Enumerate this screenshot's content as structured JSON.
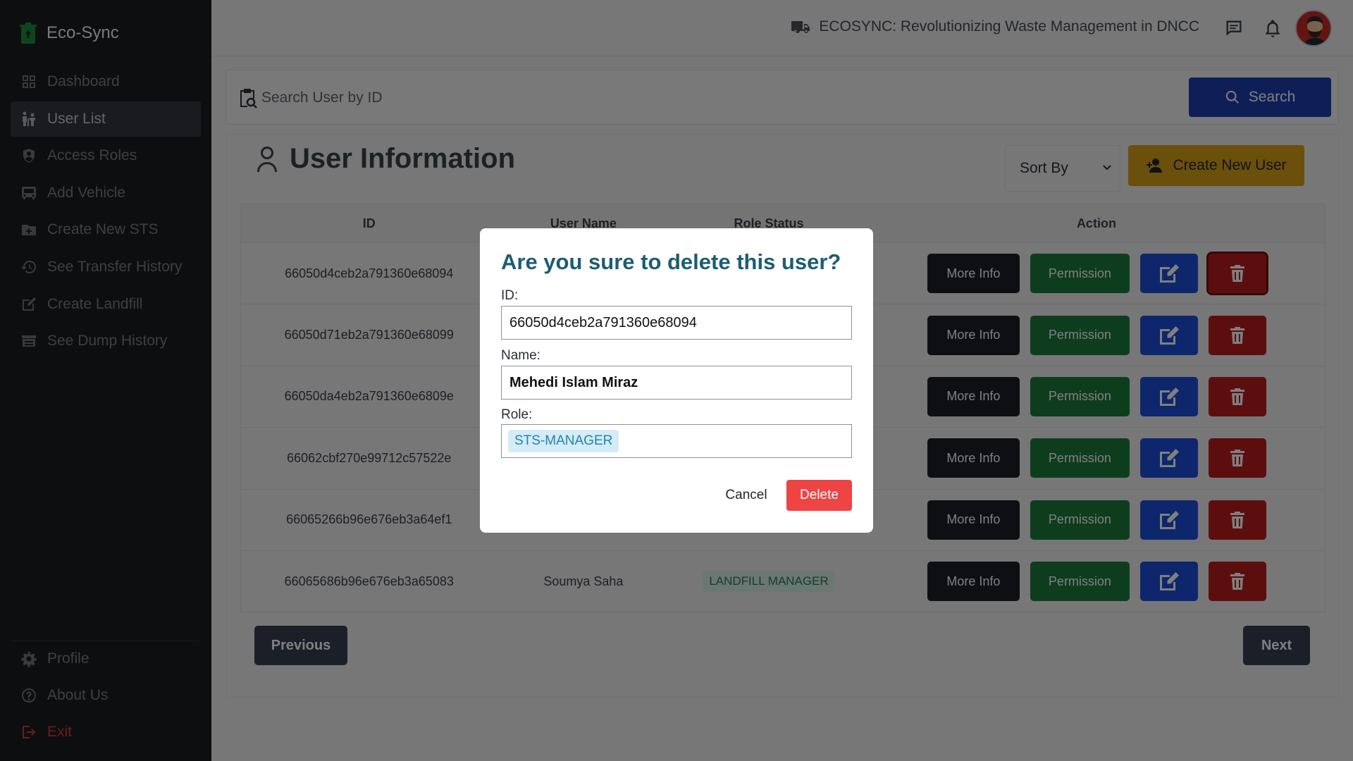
{
  "app": {
    "name": "Eco-Sync"
  },
  "sidebar": {
    "items": [
      {
        "label": "Dashboard",
        "icon": "dashboard-icon"
      },
      {
        "label": "User List",
        "icon": "users-icon",
        "active": true
      },
      {
        "label": "Access Roles",
        "icon": "shield-icon"
      },
      {
        "label": "Add Vehicle",
        "icon": "bus-icon"
      },
      {
        "label": "Create New STS",
        "icon": "folder-plus-icon"
      },
      {
        "label": "See Transfer History",
        "icon": "history-icon"
      },
      {
        "label": "Create Landfill",
        "icon": "edit-icon"
      },
      {
        "label": "See Dump History",
        "icon": "warehouse-icon"
      }
    ],
    "bottom_items": [
      {
        "label": "Profile",
        "icon": "gear-icon"
      },
      {
        "label": "About Us",
        "icon": "help-icon"
      },
      {
        "label": "Exit",
        "icon": "exit-icon"
      }
    ]
  },
  "topbar": {
    "title": "ECOSYNC: Revolutionizing Waste Management in DNCC"
  },
  "search": {
    "placeholder": "Search User by ID",
    "button_label": "Search"
  },
  "panel": {
    "title": "User Information",
    "sort_label": "Sort By",
    "create_label": "Create New User"
  },
  "table": {
    "headers": {
      "id": "ID",
      "name": "User Name",
      "role": "Role Status",
      "action": "Action"
    },
    "rows": [
      {
        "id": "66050d4ceb2a791360e68094",
        "name": "",
        "role": ""
      },
      {
        "id": "66050d71eb2a791360e68099",
        "name": "",
        "role": ""
      },
      {
        "id": "66050da4eb2a791360e6809e",
        "name": "",
        "role": ""
      },
      {
        "id": "66062cbf270e99712c57522e",
        "name": "",
        "role": ""
      },
      {
        "id": "66065266b96e676eb3a64ef1",
        "name": "",
        "role": ""
      },
      {
        "id": "66065686b96e676eb3a65083",
        "name": "Soumya Saha",
        "role": "LANDFILL MANAGER"
      }
    ],
    "more_info_label": "More Info",
    "permission_label": "Permission"
  },
  "pagination": {
    "prev_label": "Previous",
    "next_label": "Next"
  },
  "modal": {
    "title": "Are you sure to delete this user?",
    "id_label": "ID:",
    "id_value": "66050d4ceb2a791360e68094",
    "name_label": "Name:",
    "name_value": "Mehedi Islam Miraz",
    "role_label": "Role:",
    "role_value": "STS-MANAGER",
    "cancel_label": "Cancel",
    "delete_label": "Delete"
  },
  "colors": {
    "sidebar_bg": "#1a1d21",
    "search_btn": "#1d3fb0",
    "create_btn": "#d4a017",
    "permission": "#1d7a3a",
    "edit": "#1d4ed8",
    "delete": "#b81c1c",
    "modal_title": "#1c5d74",
    "modal_delete": "#ef4444"
  }
}
